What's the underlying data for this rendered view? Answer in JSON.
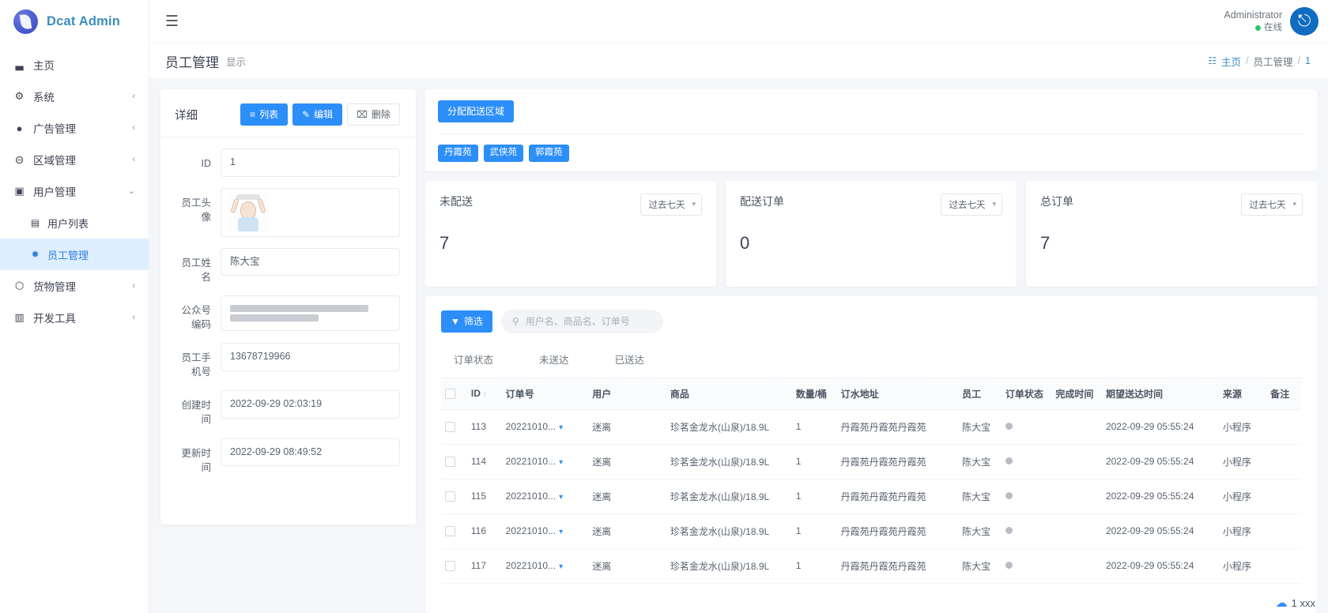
{
  "brand": {
    "name": "Dcat Admin"
  },
  "topbar": {
    "hamburger_icon": "hamburger-icon",
    "user_name": "Administrator",
    "user_status": "在线",
    "avatar_icon": "power-icon"
  },
  "pagehead": {
    "title": "员工管理",
    "subtitle": "显示",
    "breadcrumb": {
      "home": "主页",
      "section": "员工管理",
      "current": "1",
      "sep": "/"
    }
  },
  "sidebar": {
    "items": [
      {
        "label": "主页",
        "icon": "chart-bar-icon",
        "caret": "",
        "active": false,
        "sub": false
      },
      {
        "label": "系统",
        "icon": "gear-icon",
        "caret": "‹",
        "active": false,
        "sub": false
      },
      {
        "label": "广告管理",
        "icon": "circle-icon",
        "caret": "‹",
        "active": false,
        "sub": false
      },
      {
        "label": "区域管理",
        "icon": "bank-icon",
        "caret": "‹",
        "active": false,
        "sub": false
      },
      {
        "label": "用户管理",
        "icon": "user-card-icon",
        "caret": "⌄",
        "active": false,
        "sub": false
      },
      {
        "label": "用户列表",
        "icon": "user-icon",
        "caret": "",
        "active": false,
        "sub": true
      },
      {
        "label": "员工管理",
        "icon": "android-icon",
        "caret": "",
        "active": true,
        "sub": true
      },
      {
        "label": "货物管理",
        "icon": "box-icon",
        "caret": "‹",
        "active": false,
        "sub": false
      },
      {
        "label": "开发工具",
        "icon": "tools-icon",
        "caret": "‹",
        "active": false,
        "sub": false
      }
    ]
  },
  "detail": {
    "title": "详细",
    "buttons": [
      {
        "label": "列表",
        "icon": "list-icon",
        "style": "primary"
      },
      {
        "label": "编辑",
        "icon": "pencil-icon",
        "style": "primary"
      },
      {
        "label": "删除",
        "icon": "trash-icon",
        "style": "light"
      }
    ],
    "fields": [
      {
        "label": "ID",
        "value": "1",
        "type": "text"
      },
      {
        "label": "员工头像",
        "value": "",
        "type": "avatar"
      },
      {
        "label": "员工姓名",
        "value": "陈大宝",
        "type": "text"
      },
      {
        "label": "公众号编码",
        "value": "",
        "type": "blurred"
      },
      {
        "label": "员工手机号",
        "value": "13678719966",
        "type": "text"
      },
      {
        "label": "创建时间",
        "value": "2022-09-29 02:03:19",
        "type": "text"
      },
      {
        "label": "更新时间",
        "value": "2022-09-29 08:49:52",
        "type": "text"
      }
    ]
  },
  "area": {
    "assign_button": "分配配送区域",
    "tags": [
      "丹霞苑",
      "武侠苑",
      "郭霞苑"
    ]
  },
  "stats": [
    {
      "title": "未配送",
      "value": "7",
      "range": "过去七天"
    },
    {
      "title": "配送订单",
      "value": "0",
      "range": "过去七天"
    },
    {
      "title": "总订单",
      "value": "7",
      "range": "过去七天"
    }
  ],
  "grid": {
    "filter_button": "筛选",
    "filter_icon": "funnel-icon",
    "search_icon": "search-icon",
    "search_placeholder": "用户名、商品名、订单号",
    "search_value": "",
    "tabs": [
      "订单状态",
      "未送达",
      "已送达"
    ],
    "columns": [
      "ID",
      "订单号",
      "用户",
      "商品",
      "数量/桶",
      "订水地址",
      "员工",
      "订单状态",
      "完成时间",
      "期望送达时间",
      "来源",
      "备注"
    ],
    "sort_column": "ID",
    "sort_icon": "↑",
    "rows": [
      {
        "id": "113",
        "order_no": "20221010...",
        "user": "迷离",
        "product": "珍茗金龙水(山泉)/18.9L",
        "qty": "1",
        "address": "丹霞苑丹霞苑丹霞苑",
        "staff": "陈大宝",
        "status": "",
        "done_time": "",
        "expect_time": "2022-09-29 05:55:24",
        "source": "小程序",
        "remark": ""
      },
      {
        "id": "114",
        "order_no": "20221010...",
        "user": "迷离",
        "product": "珍茗金龙水(山泉)/18.9L",
        "qty": "1",
        "address": "丹霞苑丹霞苑丹霞苑",
        "staff": "陈大宝",
        "status": "",
        "done_time": "",
        "expect_time": "2022-09-29 05:55:24",
        "source": "小程序",
        "remark": ""
      },
      {
        "id": "115",
        "order_no": "20221010...",
        "user": "迷离",
        "product": "珍茗金龙水(山泉)/18.9L",
        "qty": "1",
        "address": "丹霞苑丹霞苑丹霞苑",
        "staff": "陈大宝",
        "status": "",
        "done_time": "",
        "expect_time": "2022-09-29 05:55:24",
        "source": "小程序",
        "remark": ""
      },
      {
        "id": "116",
        "order_no": "20221010...",
        "user": "迷离",
        "product": "珍茗金龙水(山泉)/18.9L",
        "qty": "1",
        "address": "丹霞苑丹霞苑丹霞苑",
        "staff": "陈大宝",
        "status": "",
        "done_time": "",
        "expect_time": "2022-09-29 05:55:24",
        "source": "小程序",
        "remark": ""
      },
      {
        "id": "117",
        "order_no": "20221010...",
        "user": "迷离",
        "product": "珍茗金龙水(山泉)/18.9L",
        "qty": "1",
        "address": "丹霞苑丹霞苑丹霞苑",
        "staff": "陈大宝",
        "status": "",
        "done_time": "",
        "expect_time": "2022-09-29 05:55:24",
        "source": "小程序",
        "remark": ""
      }
    ]
  },
  "float_badge": {
    "label": "1 xxx",
    "icon": "cloud-icon"
  },
  "colors": {
    "primary": "#2c8ef8",
    "brand": "#3c8dbc",
    "online": "#28c76f",
    "sidebar_active_bg": "#ddeeff"
  }
}
